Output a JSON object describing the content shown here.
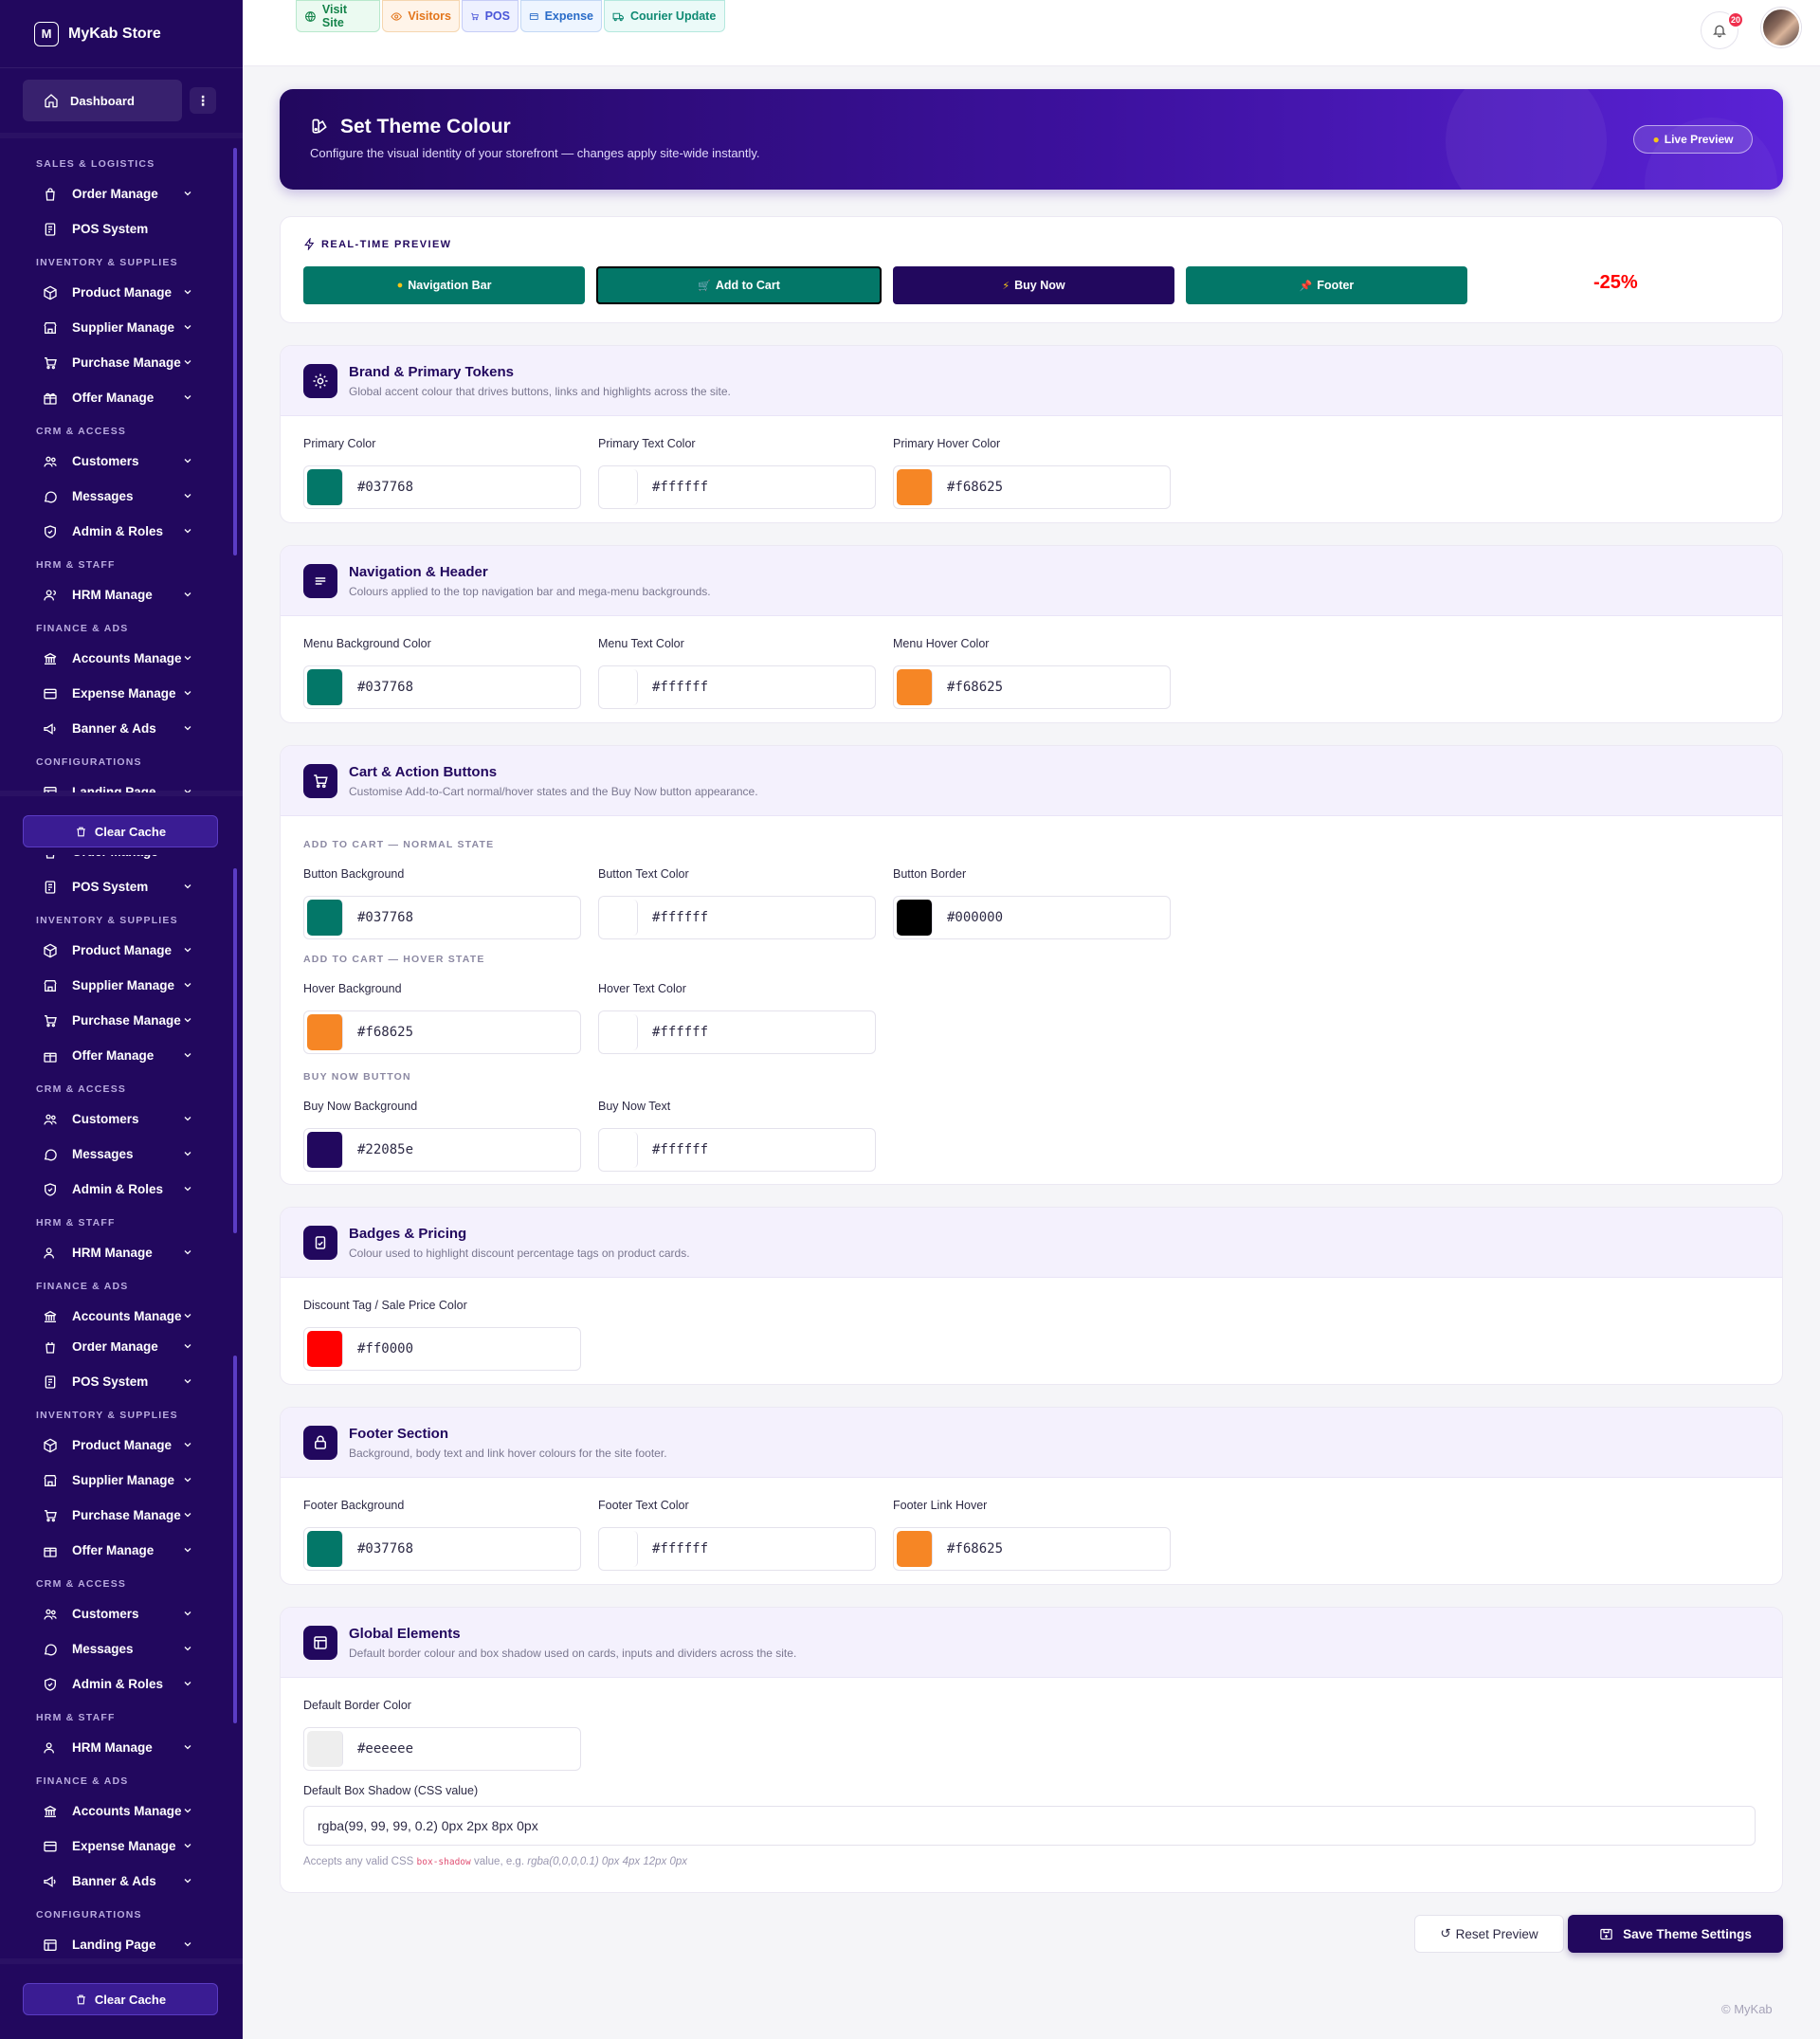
{
  "app": {
    "logo_letter": "M",
    "name": "MyKab Store"
  },
  "sidebar": {
    "dashboard_label": "Dashboard",
    "more_icon": "⋮",
    "clear_cache_label": "Clear Cache",
    "groups": {
      "sales": "Sales & Logistics",
      "inventory": "Inventory & Supplies",
      "crm": "CRM & Access",
      "hrm": "HRM & Staff",
      "finance": "Finance & Ads",
      "config": "Configurations"
    },
    "items": {
      "order": "Order Manage",
      "pos": "POS System",
      "product": "Product Manage",
      "supplier": "Supplier Manage",
      "purchase": "Purchase Manage",
      "offer": "Offer Manage",
      "customers": "Customers",
      "messages": "Messages",
      "admin": "Admin & Roles",
      "hrm": "HRM Manage",
      "accounts": "Accounts Manage",
      "expense": "Expense Manage",
      "banner": "Banner & Ads",
      "landing": "Landing Page"
    }
  },
  "topbar": {
    "quick_actions": {
      "visit_site": "Visit Site",
      "visitors": "Visitors",
      "pos": "POS",
      "expense": "Expense",
      "courier": "Courier Update"
    },
    "notification_count": "20"
  },
  "hero": {
    "title": "Set Theme Colour",
    "subtitle": "Configure the visual identity of your storefront — changes apply site-wide instantly.",
    "live_preview_label": "Live Preview"
  },
  "preview": {
    "label": "Real-time Preview",
    "nav_bar": "Navigation Bar",
    "add_to_cart": "Add to Cart",
    "buy_now": "Buy Now",
    "footer": "Footer",
    "discount": "-25%"
  },
  "sections": {
    "brand": {
      "title": "Brand & Primary Tokens",
      "desc": "Global accent colour that drives buttons, links and highlights across the site.",
      "primary_color_label": "Primary Color",
      "primary_color": "#037768",
      "primary_text_label": "Primary Text Color",
      "primary_text": "#ffffff",
      "primary_hover_label": "Primary Hover Color",
      "primary_hover": "#f68625"
    },
    "nav": {
      "title": "Navigation & Header",
      "desc": "Colours applied to the top navigation bar and mega-menu backgrounds.",
      "bg_label": "Menu Background Color",
      "bg": "#037768",
      "text_label": "Menu Text Color",
      "text": "#ffffff",
      "hover_label": "Menu Hover Color",
      "hover": "#f68625"
    },
    "cart": {
      "title": "Cart & Action Buttons",
      "desc": "Customise Add-to-Cart normal/hover states and the Buy Now button appearance.",
      "normal_heading": "Add to Cart — Normal State",
      "btn_bg_label": "Button Background",
      "btn_bg": "#037768",
      "btn_text_label": "Button Text Color",
      "btn_text": "#ffffff",
      "btn_border_label": "Button Border",
      "btn_border": "#000000",
      "hover_heading": "Add to Cart — Hover State",
      "hover_bg_label": "Hover Background",
      "hover_bg": "#f68625",
      "hover_text_label": "Hover Text Color",
      "hover_text": "#ffffff",
      "buy_heading": "Buy Now Button",
      "buy_bg_label": "Buy Now Background",
      "buy_bg": "#22085e",
      "buy_text_label": "Buy Now Text",
      "buy_text": "#ffffff"
    },
    "badges": {
      "title": "Badges & Pricing",
      "desc": "Colour used to highlight discount percentage tags on product cards.",
      "discount_label": "Discount Tag / Sale Price Color",
      "discount": "#ff0000"
    },
    "footer": {
      "title": "Footer Section",
      "desc": "Background, body text and link hover colours for the site footer.",
      "bg_label": "Footer Background",
      "bg": "#037768",
      "text_label": "Footer Text Color",
      "text": "#ffffff",
      "hover_label": "Footer Link Hover",
      "hover": "#f68625"
    },
    "global": {
      "title": "Global Elements",
      "desc": "Default border colour and box shadow used on cards, inputs and dividers across the site.",
      "border_label": "Default Border Color",
      "border": "#eeeeee",
      "shadow_label": "Default Box Shadow (CSS value)",
      "shadow": "rgba(99, 99, 99, 0.2) 0px 2px 8px 0px",
      "help_prefix": "Accepts any valid CSS",
      "help_code": "box-shadow",
      "help_mid": "value, e.g.",
      "help_example": "rgba(0,0,0,0.1) 0px 4px 12px 0px"
    }
  },
  "actions": {
    "reset": "Reset Preview",
    "save": "Save Theme Settings"
  },
  "footer_text": "© MyKab",
  "colors": {
    "brand_dark": "#22085e",
    "accent_teal": "#037768",
    "accent_orange": "#f68625",
    "discount_red": "#ff0000"
  }
}
